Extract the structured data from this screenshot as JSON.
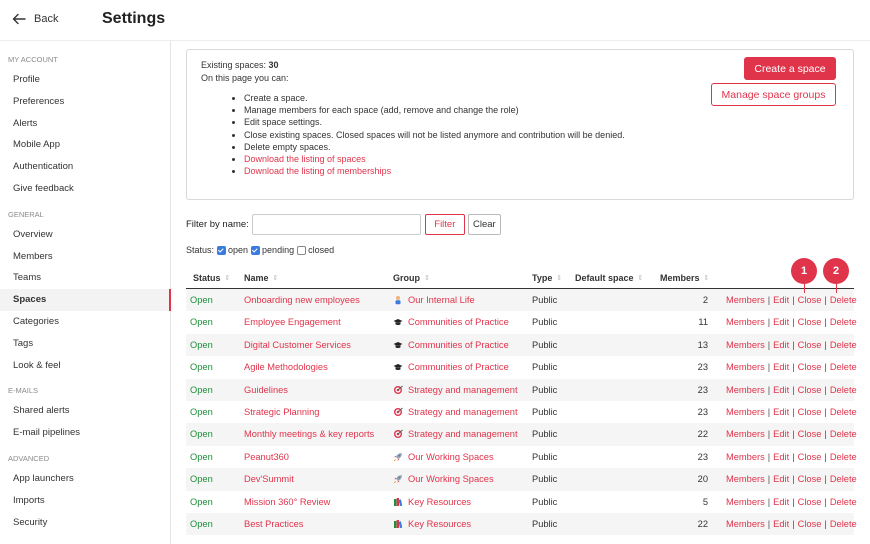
{
  "header": {
    "back_label": "Back",
    "title": "Settings"
  },
  "sidebar": {
    "sections": [
      {
        "label": "MY ACCOUNT",
        "items": [
          "Profile",
          "Preferences",
          "Alerts",
          "Mobile App",
          "Authentication",
          "Give feedback"
        ]
      },
      {
        "label": "GENERAL",
        "items": [
          "Overview",
          "Members",
          "Teams",
          "Spaces",
          "Categories",
          "Tags",
          "Look & feel"
        ]
      },
      {
        "label": "E-MAILS",
        "items": [
          "Shared alerts",
          "E-mail pipelines"
        ]
      },
      {
        "label": "ADVANCED",
        "items": [
          "App launchers",
          "Imports",
          "Security"
        ]
      }
    ],
    "active": "Spaces"
  },
  "info": {
    "existing_label": "Existing spaces: ",
    "existing_count": "30",
    "intro": "On this page you can:",
    "bullets": [
      "Create a space.",
      "Manage members for each space (add, remove and change the role)",
      "Edit space settings.",
      "Close existing spaces. Closed spaces will not be listed anymore and contribution will be denied.",
      "Delete empty spaces."
    ],
    "links": [
      "Download the listing of spaces",
      "Download the listing of memberships"
    ],
    "create_button": "Create a space",
    "manage_button": "Manage space groups"
  },
  "filter": {
    "label": "Filter by name:",
    "value": "",
    "filter_button": "Filter",
    "clear_button": "Clear"
  },
  "status_filter": {
    "label": "Status:",
    "options": [
      {
        "label": "open",
        "checked": true
      },
      {
        "label": "pending",
        "checked": true
      },
      {
        "label": "closed",
        "checked": false
      }
    ]
  },
  "table": {
    "columns": {
      "status": "Status",
      "name": "Name",
      "group": "Group",
      "type": "Type",
      "default_space": "Default space",
      "members": "Members"
    },
    "action_labels": {
      "members": "Members",
      "edit": "Edit",
      "close": "Close",
      "delete": "Delete"
    },
    "rows": [
      {
        "status": "Open",
        "name": "Onboarding new employees",
        "group": "Our Internal Life",
        "group_icon": "person-icon",
        "type": "Public",
        "members": "2"
      },
      {
        "status": "Open",
        "name": "Employee Engagement",
        "group": "Communities of Practice",
        "group_icon": "graduation-cap-icon",
        "type": "Public",
        "members": "11"
      },
      {
        "status": "Open",
        "name": "Digital Customer Services",
        "group": "Communities of Practice",
        "group_icon": "graduation-cap-icon",
        "type": "Public",
        "members": "13"
      },
      {
        "status": "Open",
        "name": "Agile Methodologies",
        "group": "Communities of Practice",
        "group_icon": "graduation-cap-icon",
        "type": "Public",
        "members": "23"
      },
      {
        "status": "Open",
        "name": "Guidelines",
        "group": "Strategy and management",
        "group_icon": "target-icon",
        "type": "Public",
        "members": "23"
      },
      {
        "status": "Open",
        "name": "Strategic Planning",
        "group": "Strategy and management",
        "group_icon": "target-icon",
        "type": "Public",
        "members": "23"
      },
      {
        "status": "Open",
        "name": "Monthly meetings & key reports",
        "group": "Strategy and management",
        "group_icon": "target-icon",
        "type": "Public",
        "members": "22"
      },
      {
        "status": "Open",
        "name": "Peanut360",
        "group": "Our Working Spaces",
        "group_icon": "rocket-icon",
        "type": "Public",
        "members": "23"
      },
      {
        "status": "Open",
        "name": "Dev'Summit",
        "group": "Our Working Spaces",
        "group_icon": "rocket-icon",
        "type": "Public",
        "members": "20"
      },
      {
        "status": "Open",
        "name": "Mission 360° Review",
        "group": "Key Resources",
        "group_icon": "books-icon",
        "type": "Public",
        "members": "5"
      },
      {
        "status": "Open",
        "name": "Best Practices",
        "group": "Key Resources",
        "group_icon": "books-icon",
        "type": "Public",
        "members": "22"
      }
    ]
  },
  "callouts": [
    "1",
    "2"
  ],
  "colors": {
    "accent": "#e0344b",
    "open_status": "#1e8f3a"
  }
}
